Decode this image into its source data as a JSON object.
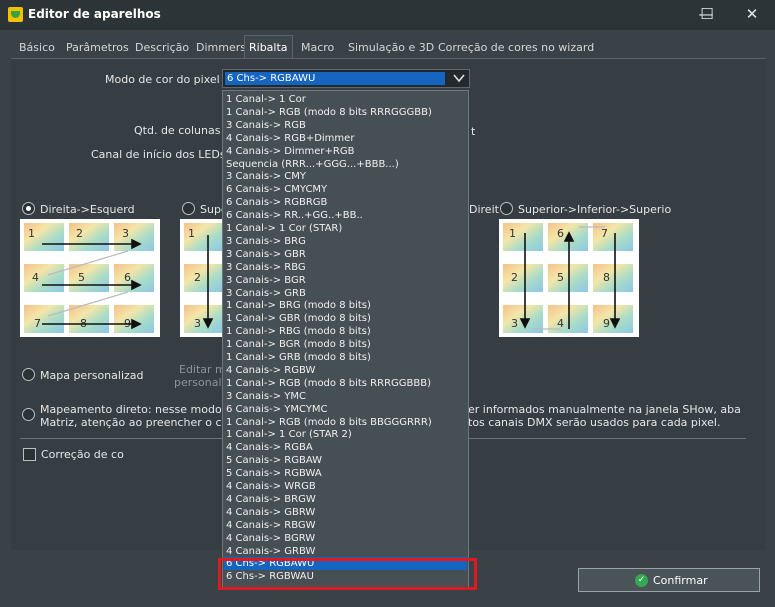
{
  "window": {
    "title": "Editor de aparelhos",
    "minimize": "—",
    "maximize": "☐",
    "close": "✕"
  },
  "tabs": [
    "Básico",
    "Parâmetros",
    "Descrição",
    "Dimmers",
    "Ribalta",
    "Macro",
    "Simulação e 3D",
    "Correção de cores no wizard"
  ],
  "active_tab": "Ribalta",
  "form": {
    "color_mode_label": "Modo de cor do pixel",
    "color_mode_value": "6 Chs-> RGBAWU",
    "columns_label": "Qtd. de colunas",
    "start_channel_label": "Canal de início dos LEDs",
    "partial_right_text": "t"
  },
  "orientation": {
    "option1": "Direita->Esquerd",
    "option2": "Supe",
    "option3": "Direit",
    "option4": "Superior->Inferior->Superio"
  },
  "custom_map": {
    "label": "Mapa personalizad",
    "edit_line1": "Editar m",
    "edit_line2": "personali"
  },
  "direct_mapping": {
    "line1_left": "Mapeamento direto: nesse modo o",
    "line1_right": "er informados manualmente na janela SHow, aba",
    "line2_left": "Matriz, atenção ao preencher o cam",
    "line2_right": "tos canais DMX serão usados para cada pixel."
  },
  "color_correction": {
    "label": "Correção de co"
  },
  "dropdown_items": [
    "1 Canal-> 1 Cor",
    "1 Canal-> RGB (modo 8 bits RRRGGGBB)",
    "3 Canais-> RGB",
    "4 Canais-> RGB+Dimmer",
    "4 Canais-> Dimmer+RGB",
    "Sequencia (RRR...+GGG...+BBB...)",
    "3 Canais-> CMY",
    "6 Canais-> CMYCMY",
    "6 Canais-> RGBRGB",
    "6 Canais-> RR..+GG..+BB..",
    "1 Canal-> 1 Cor (STAR)",
    "3 Canais-> BRG",
    "3 Canais-> GBR",
    "3 Canais-> RBG",
    "3 Canais-> BGR",
    "3 Canais-> GRB",
    "1 Canal-> BRG (modo 8 bits)",
    "1 Canal-> GBR (modo 8 bits)",
    "1 Canal-> RBG (modo 8 bits)",
    "1 Canal-> BGR (modo 8 bits)",
    "1 Canal-> GRB (modo 8 bits)",
    "4 Canais-> RGBW",
    "1 Canal-> RGB (modo 8 bits RRRGGBBB)",
    "3 Canais-> YMC",
    "6 Canais-> YMCYMC",
    "1 Canal-> RGB (modo 8 bits BBGGGRRR)",
    "1 Canal-> 1 Cor (STAR 2)",
    "4 Canais-> RGBA",
    "5 Canais-> RGBAW",
    "5 Canais-> RGBWA",
    "4 Canais-> WRGB",
    "4 Canais-> BRGW",
    "4 Canais-> GBRW",
    "4 Canais-> RBGW",
    "4 Canais-> BGRW",
    "4 Canais-> GRBW",
    "6 Chs-> RGBAWU",
    "6 Chs-> RGBWAU"
  ],
  "selected_index": 36,
  "confirm": {
    "label": "Confirmar"
  },
  "diagrams": {
    "d1": [
      "1",
      "2",
      "3",
      "4",
      "5",
      "6",
      "7",
      "8",
      "9"
    ],
    "d2": [
      "1",
      "2",
      "3"
    ],
    "d4": [
      "1",
      "6",
      "7",
      "2",
      "5",
      "8",
      "3",
      "4",
      "9"
    ]
  },
  "colors": {
    "accent": "#1565c0",
    "highlight": "#e0191f",
    "confirm_icon": "#34a853"
  }
}
